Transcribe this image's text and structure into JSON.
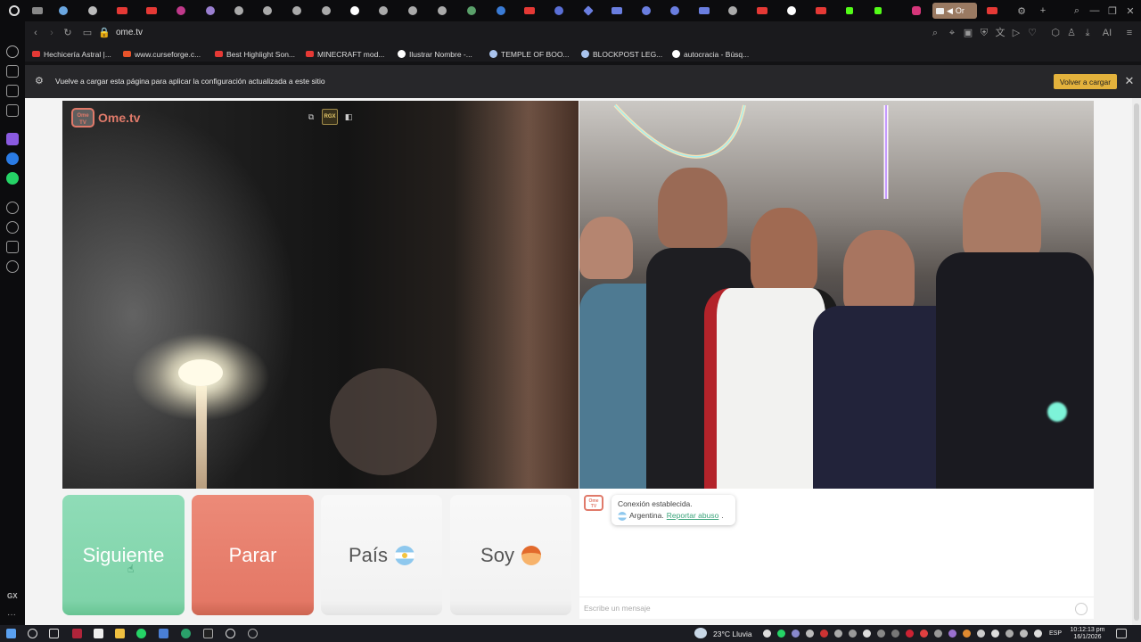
{
  "browser": {
    "url": "ome.tv",
    "active_tab_label": "Or",
    "bookmarks": [
      {
        "label": "Hechicería Astral |...",
        "color": "#e53935"
      },
      {
        "label": "www.curseforge.c...",
        "color": "#e8532a"
      },
      {
        "label": "Best Highlight Son...",
        "color": "#e53935"
      },
      {
        "label": "MINECRAFT mod...",
        "color": "#e53935"
      },
      {
        "label": "Ilustrar Nombre -...",
        "color": "#ffffff"
      },
      {
        "label": "TEMPLE OF BOO...",
        "color": "#aac4ee"
      },
      {
        "label": "BLOCKPOST LEG...",
        "color": "#aac4ee"
      },
      {
        "label": "autocracia - Búsq...",
        "color": "#ffffff"
      }
    ],
    "infobar": {
      "message": "Vuelve a cargar esta página para aplicar la configuración actualizada a este sitio",
      "reload_label": "Volver a cargar"
    },
    "sidebar_label": "GX",
    "sidebar_more": "···"
  },
  "omegle": {
    "logo_text": "Ome.tv",
    "logo_badge": "Ome TV",
    "overlay_button": "RGX",
    "buttons": {
      "next": "Siguiente",
      "stop": "Parar",
      "country": "País",
      "gender": "Soy"
    },
    "chat": {
      "status": "Conexión establecida.",
      "country": "Argentina.",
      "report_link": "Reportar abuso",
      "report_suffix": ".",
      "input_placeholder": "Escribe un mensaje"
    }
  },
  "taskbar": {
    "weather": "23°C  Lluvia",
    "language": "ESP",
    "time": "10:12:13 pm",
    "date": "16/1/2026"
  },
  "colors": {
    "next_green": "#7fd3a9",
    "stop_red": "#e47866",
    "reload_yellow": "#e3b23c",
    "link_green": "#3aa37a"
  }
}
